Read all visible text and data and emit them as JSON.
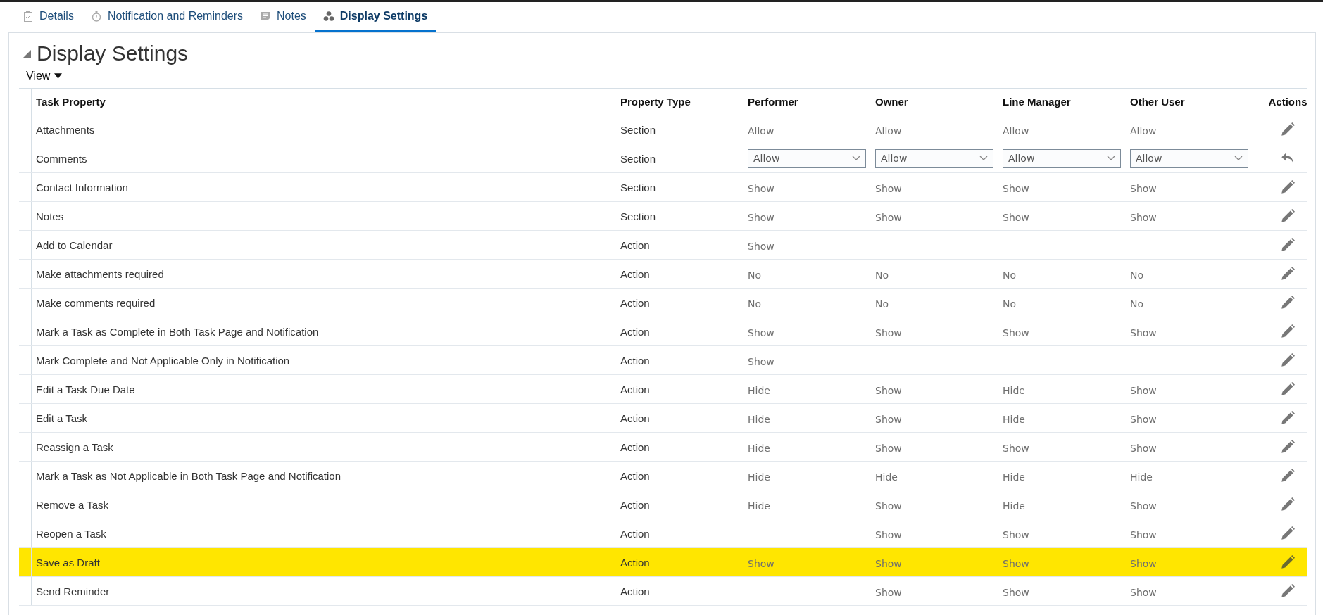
{
  "tabs": [
    {
      "label": "Details",
      "selected": false
    },
    {
      "label": "Notification and Reminders",
      "selected": false
    },
    {
      "label": "Notes",
      "selected": false
    },
    {
      "label": "Display Settings",
      "selected": true
    }
  ],
  "section": {
    "title": "Display Settings",
    "expanded": true,
    "view_menu": "View"
  },
  "table": {
    "columns": [
      "Task Property",
      "Property Type",
      "Performer",
      "Owner",
      "Line Manager",
      "Other User",
      "Actions"
    ],
    "rows": [
      {
        "kind": "view",
        "highlighted": false,
        "property": "Attachments",
        "type": "Section",
        "performer": "Allow",
        "owner": "Allow",
        "line_manager": "Allow",
        "other_user": "Allow"
      },
      {
        "kind": "edit",
        "highlighted": false,
        "property": "Comments",
        "type": "Section",
        "performer": "Allow",
        "owner": "Allow",
        "line_manager": "Allow",
        "other_user": "Allow"
      },
      {
        "kind": "view",
        "highlighted": false,
        "property": "Contact Information",
        "type": "Section",
        "performer": "Show",
        "owner": "Show",
        "line_manager": "Show",
        "other_user": "Show"
      },
      {
        "kind": "view",
        "highlighted": false,
        "property": "Notes",
        "type": "Section",
        "performer": "Show",
        "owner": "Show",
        "line_manager": "Show",
        "other_user": "Show"
      },
      {
        "kind": "view",
        "highlighted": false,
        "property": "Add to Calendar",
        "type": "Action",
        "performer": "Show"
      },
      {
        "kind": "view",
        "highlighted": false,
        "property": "Make attachments required",
        "type": "Action",
        "performer": "No",
        "owner": "No",
        "line_manager": "No",
        "other_user": "No"
      },
      {
        "kind": "view",
        "highlighted": false,
        "property": "Make comments required",
        "type": "Action",
        "performer": "No",
        "owner": "No",
        "line_manager": "No",
        "other_user": "No"
      },
      {
        "kind": "view",
        "highlighted": false,
        "property": "Mark a Task as Complete in Both Task Page and Notification",
        "type": "Action",
        "performer": "Show",
        "owner": "Show",
        "line_manager": "Show",
        "other_user": "Show"
      },
      {
        "kind": "view",
        "highlighted": false,
        "property": "Mark Complete and Not Applicable Only in Notification",
        "type": "Action",
        "performer": "Show"
      },
      {
        "kind": "view",
        "highlighted": false,
        "property": "Edit a Task Due Date",
        "type": "Action",
        "performer": "Hide",
        "owner": "Show",
        "line_manager": "Hide",
        "other_user": "Show"
      },
      {
        "kind": "view",
        "highlighted": false,
        "property": "Edit a Task",
        "type": "Action",
        "performer": "Hide",
        "owner": "Show",
        "line_manager": "Hide",
        "other_user": "Show"
      },
      {
        "kind": "view",
        "highlighted": false,
        "property": "Reassign a Task",
        "type": "Action",
        "performer": "Hide",
        "owner": "Show",
        "line_manager": "Show",
        "other_user": "Show"
      },
      {
        "kind": "view",
        "highlighted": false,
        "property": "Mark a Task as Not Applicable in Both Task Page and Notification",
        "type": "Action",
        "performer": "Hide",
        "owner": "Hide",
        "line_manager": "Hide",
        "other_user": "Hide"
      },
      {
        "kind": "view",
        "highlighted": false,
        "property": "Remove a Task",
        "type": "Action",
        "performer": "Hide",
        "owner": "Show",
        "line_manager": "Hide",
        "other_user": "Show"
      },
      {
        "kind": "view",
        "highlighted": false,
        "property": "Reopen a Task",
        "type": "Action",
        "owner": "Show",
        "line_manager": "Show",
        "other_user": "Show"
      },
      {
        "kind": "view",
        "highlighted": true,
        "property": "Save as Draft",
        "type": "Action",
        "performer": "Show",
        "owner": "Show",
        "line_manager": "Show",
        "other_user": "Show"
      },
      {
        "kind": "view",
        "highlighted": false,
        "property": "Send Reminder",
        "type": "Action",
        "owner": "Show",
        "line_manager": "Show",
        "other_user": "Show"
      }
    ]
  }
}
